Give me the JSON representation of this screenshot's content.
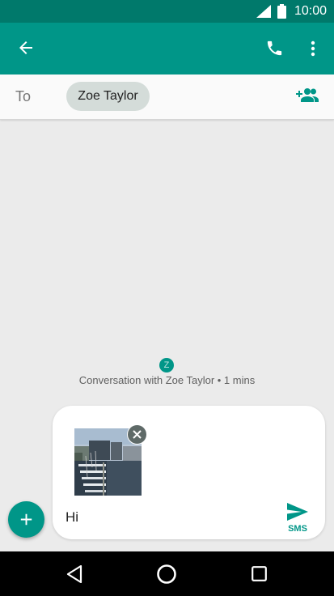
{
  "status_bar": {
    "time": "10:00"
  },
  "app_bar": {
    "back_icon": "arrow-left-icon",
    "call_icon": "phone-icon",
    "menu_icon": "more-vert-icon"
  },
  "recipient": {
    "to_label": "To",
    "chip_name": "Zoe Taylor",
    "add_icon": "add-person-icon"
  },
  "conversation": {
    "avatar_letter": "Z",
    "info": "Conversation with Zoe Taylor • 1 mins"
  },
  "compose": {
    "message": "Hi",
    "send_label": "SMS",
    "attachment": "photo-thumbnail"
  },
  "colors": {
    "primary": "#009688",
    "primary_dark": "#00796b",
    "background": "#ebebeb"
  }
}
